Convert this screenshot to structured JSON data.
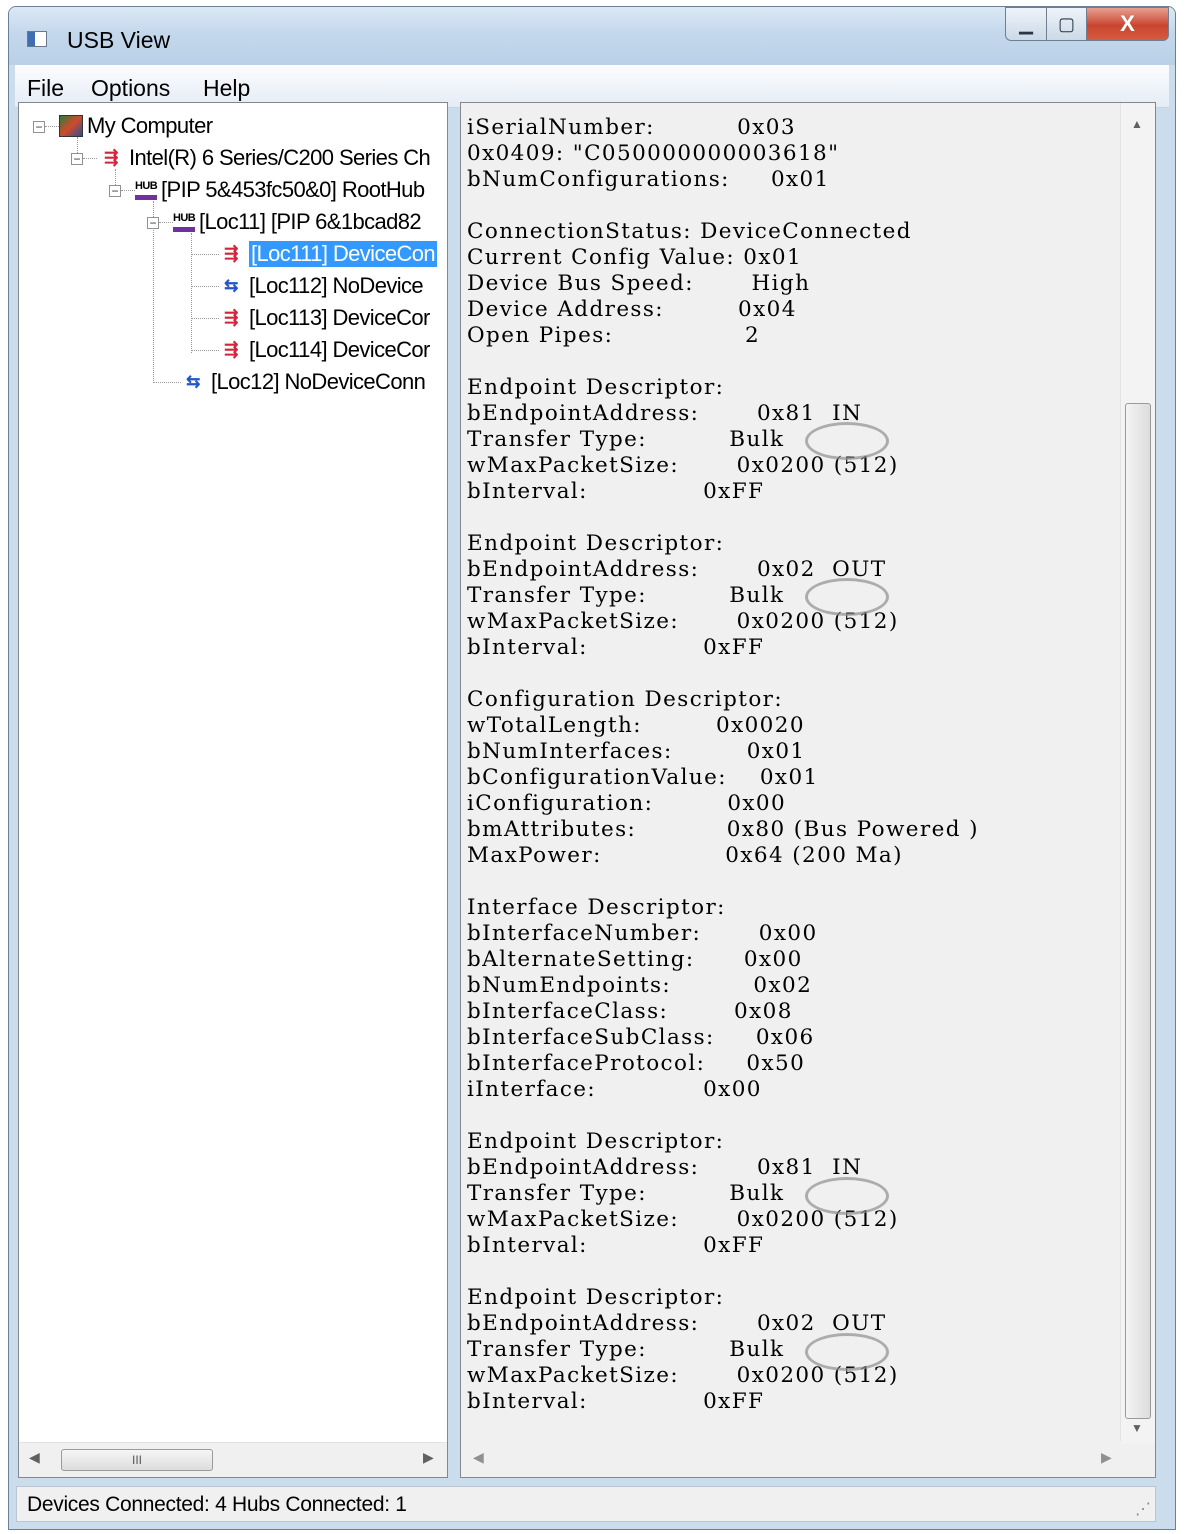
{
  "window": {
    "title": "USB View"
  },
  "caption_buttons": {
    "minimize": "▁",
    "maximize": "▢",
    "close": "X"
  },
  "menu": [
    "File",
    "Options",
    "Help"
  ],
  "tree": [
    {
      "label": "My Computer",
      "icon": "computer-icon",
      "expanded": true
    },
    {
      "label": "Intel(R) 6 Series/C200 Series Ch",
      "icon": "usb-controller-icon",
      "expanded": true
    },
    {
      "label": "[PIP 5&453fc50&0] RootHub",
      "icon": "hub-icon",
      "expanded": true
    },
    {
      "label": "[Loc11] [PIP 6&1bcad82",
      "icon": "hub-icon",
      "expanded": true
    },
    {
      "label": "[Loc111] DeviceCon",
      "icon": "usb-device-connected-icon",
      "selected": true
    },
    {
      "label": "[Loc112] NoDevice",
      "icon": "usb-port-empty-icon"
    },
    {
      "label": "[Loc113] DeviceCor",
      "icon": "usb-device-connected-icon"
    },
    {
      "label": "[Loc114] DeviceCor",
      "icon": "usb-device-connected-icon"
    },
    {
      "label": "[Loc12] NoDeviceConn",
      "icon": "usb-port-empty-icon"
    }
  ],
  "details": [
    "iSerialNumber:          0x03",
    "0x0409: \"C050000000003618\"",
    "bNumConfigurations:     0x01",
    "",
    "ConnectionStatus: DeviceConnected",
    "Current Config Value: 0x01",
    "Device Bus Speed:       High",
    "Device Address:         0x04",
    "Open Pipes:                2",
    "",
    "Endpoint Descriptor:",
    "bEndpointAddress:       0x81  IN",
    "Transfer Type:          Bulk",
    "wMaxPacketSize:       0x0200 (512)",
    "bInterval:              0xFF",
    "",
    "Endpoint Descriptor:",
    "bEndpointAddress:       0x02  OUT",
    "Transfer Type:          Bulk",
    "wMaxPacketSize:       0x0200 (512)",
    "bInterval:              0xFF",
    "",
    "Configuration Descriptor:",
    "wTotalLength:         0x0020",
    "bNumInterfaces:         0x01",
    "bConfigurationValue:    0x01",
    "iConfiguration:         0x00",
    "bmAttributes:           0x80 (Bus Powered )",
    "MaxPower:               0x64 (200 Ma)",
    "",
    "Interface Descriptor:",
    "bInterfaceNumber:       0x00",
    "bAlternateSetting:      0x00",
    "bNumEndpoints:          0x02",
    "bInterfaceClass:        0x08",
    "bInterfaceSubClass:     0x06",
    "bInterfaceProtocol:     0x50",
    "iInterface:             0x00",
    "",
    "Endpoint Descriptor:",
    "bEndpointAddress:       0x81  IN",
    "Transfer Type:          Bulk",
    "wMaxPacketSize:       0x0200 (512)",
    "bInterval:              0xFF",
    "",
    "Endpoint Descriptor:",
    "bEndpointAddress:       0x02  OUT",
    "Transfer Type:          Bulk",
    "wMaxPacketSize:       0x0200 (512)",
    "bInterval:              0xFF"
  ],
  "status": {
    "text": "Devices Connected: 4   Hubs Connected: 1"
  },
  "scrollbars": {
    "left_thumb_grip": "III"
  }
}
